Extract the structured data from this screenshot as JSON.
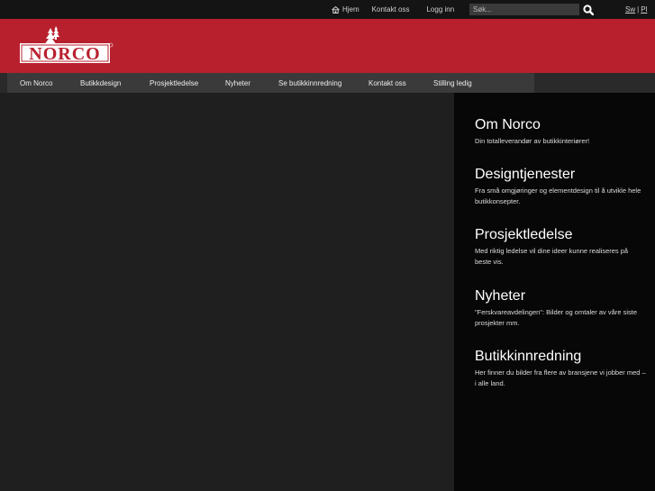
{
  "topbar": {
    "home_label": "Hjem",
    "contact_label": "Kontakt oss",
    "login_label": "Logg inn",
    "search_placeholder": "Søk...",
    "lang_sw": "Sw",
    "lang_sep": "|",
    "lang_pl": "Pl"
  },
  "logo": {
    "text": "NORCO",
    "brand_color": "#b8202e"
  },
  "nav": {
    "items": [
      {
        "label": "Om Norco"
      },
      {
        "label": "Butikkdesign"
      },
      {
        "label": "Prosjektledelse"
      },
      {
        "label": "Nyheter"
      },
      {
        "label": "Se butikkinnredning"
      },
      {
        "label": "Kontakt oss"
      },
      {
        "label": "Stilling ledig"
      }
    ]
  },
  "sidebar": {
    "blocks": [
      {
        "title": "Om Norco",
        "desc": "Din totalleverandør av butikkinteriører!"
      },
      {
        "title": "Designtjenester",
        "desc": "Fra små omgjøringer og elementdesign til å utvikle hele butikkonsepter."
      },
      {
        "title": "Prosjektledelse",
        "desc": "Med riktig ledelse vil dine ideer kunne realiseres på beste vis."
      },
      {
        "title": "Nyheter",
        "desc": "\"Ferskvareavdelingen\": Bilder og omtaler av våre siste prosjekter mm."
      },
      {
        "title": "Butikkinnredning",
        "desc": "Her finner du bilder fra flere av bransjene vi jobber med – i alle land."
      }
    ]
  }
}
